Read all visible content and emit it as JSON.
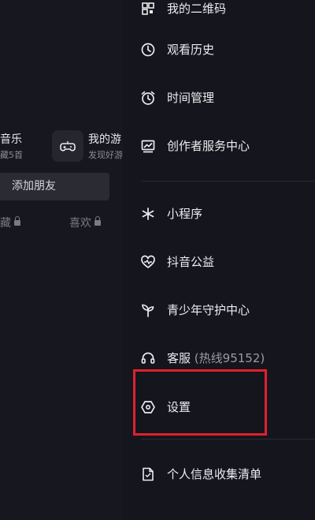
{
  "left_panel": {
    "music_title": "音乐",
    "music_sub": "藏5首",
    "game_title": "我的游",
    "game_sub": "发现好游",
    "add_friend_label": "添加朋友",
    "tab_collect_label": "藏",
    "tab_like_label": "喜欢"
  },
  "drawer": {
    "items": [
      {
        "label": "我的二维码",
        "icon": "qrcode-icon"
      },
      {
        "label": "观看历史",
        "icon": "clock-icon"
      },
      {
        "label": "时间管理",
        "icon": "alarm-clock-icon"
      },
      {
        "label": "创作者服务中心",
        "icon": "chart-icon"
      },
      {
        "label": "小程序",
        "icon": "mini-program-icon"
      },
      {
        "label": "抖音公益",
        "icon": "heart-icon"
      },
      {
        "label": "青少年守护中心",
        "icon": "sprout-icon"
      },
      {
        "label": "客服",
        "extra": "(热线95152)",
        "icon": "headset-icon"
      },
      {
        "label": "设置",
        "icon": "hexagon-settings-icon"
      },
      {
        "label": "个人信息收集清单",
        "icon": "document-icon"
      }
    ]
  },
  "highlight_color": "#e0212c"
}
